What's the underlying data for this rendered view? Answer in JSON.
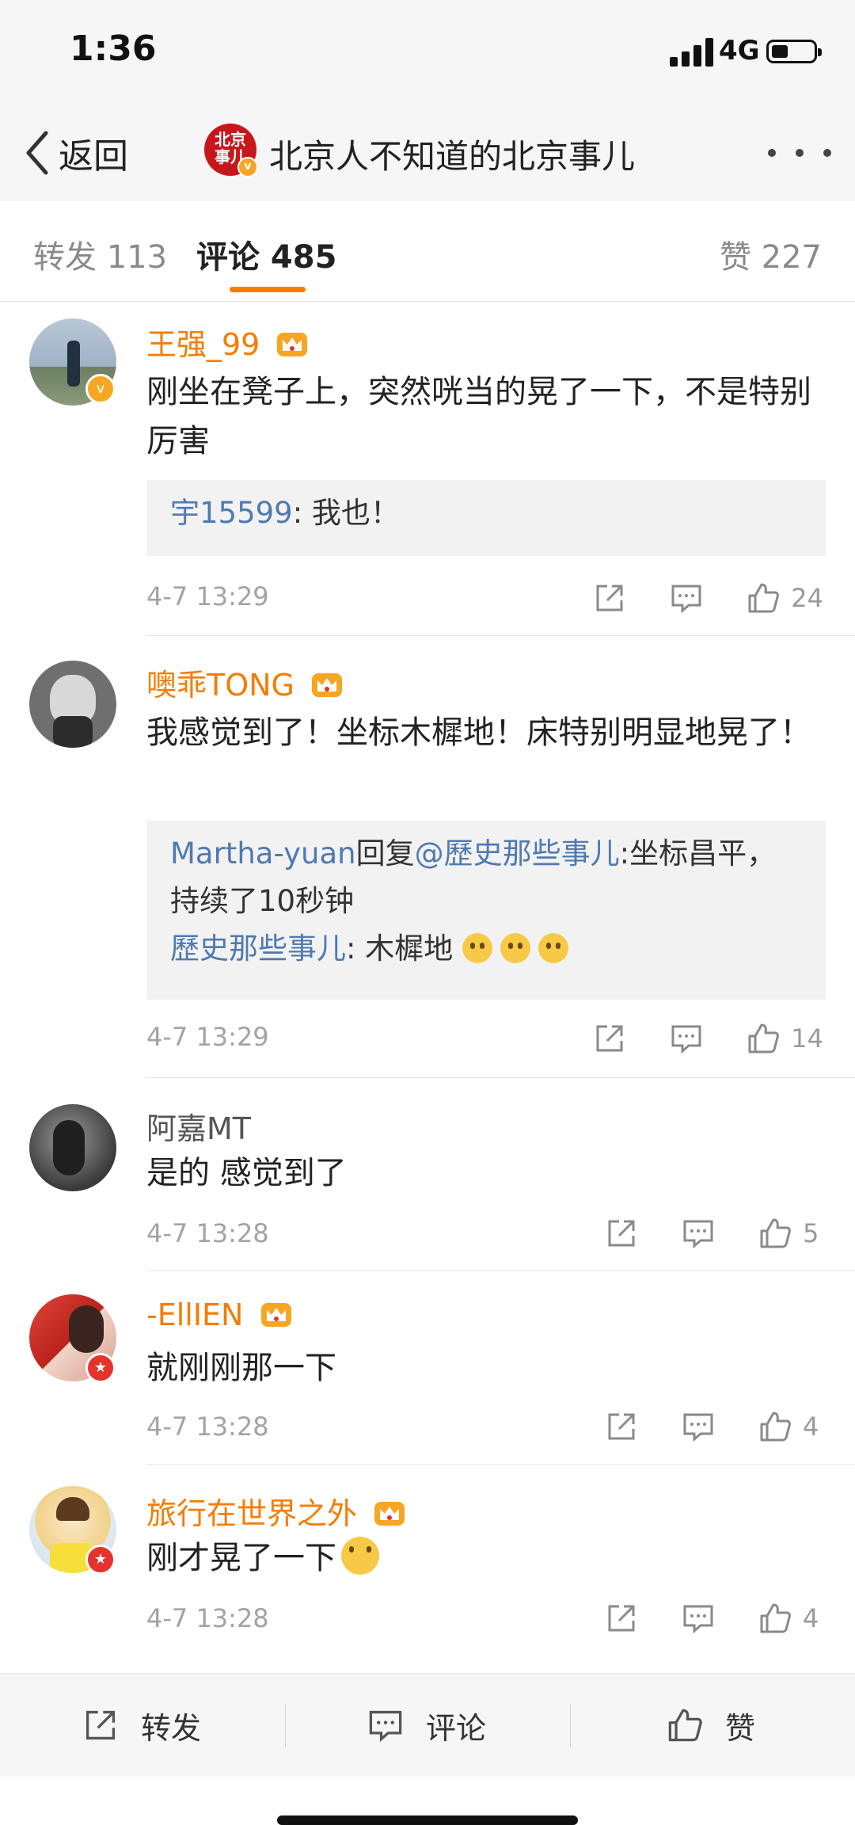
{
  "status_bar": {
    "time": "1:36",
    "network": "4G"
  },
  "nav": {
    "back_label": "返回",
    "title": "北京人不知道的北京事儿",
    "avatar_text": "北京事儿"
  },
  "tabs": [
    {
      "label": "转发 113",
      "active": false
    },
    {
      "label": "评论 485",
      "active": true
    },
    {
      "label": "赞 227",
      "active": false
    }
  ],
  "comments": [
    {
      "username": "王强_99",
      "vip": true,
      "badge": "v-gold",
      "text": "刚坐在凳子上，突然咣当的晃了一下，不是特别厉害",
      "replies": [
        {
          "user": "宇15599",
          "text": ": 我也！"
        }
      ],
      "time": "4-7 13:29",
      "likes": "24"
    },
    {
      "username": "噢乖TONG",
      "vip": true,
      "badge": "",
      "text": "我感觉到了！坐标木樨地！床特别明显地晃了！",
      "replies": [
        {
          "user": "Martha-yuan",
          "mid": "回复",
          "user2": "@歷史那些事儿",
          "text": ":坐标昌平，持续了10秒钟"
        },
        {
          "user": "歷史那些事儿",
          "text": ": 木樨地"
        }
      ],
      "time": "4-7 13:29",
      "likes": "14"
    },
    {
      "username": "阿嘉MT",
      "vip": false,
      "badge": "",
      "text": "是的  感觉到了",
      "replies": [],
      "time": "4-7 13:28",
      "likes": "5"
    },
    {
      "username": "-EllIEN",
      "vip": true,
      "badge": "v-red",
      "text": "就刚刚那一下",
      "replies": [],
      "time": "4-7 13:28",
      "likes": "4"
    },
    {
      "username": "旅行在世界之外",
      "vip": true,
      "badge": "v-red",
      "text": "刚才晃了一下",
      "replies": [],
      "time": "4-7 13:28",
      "likes": "4"
    }
  ],
  "bottom_bar": {
    "repost": "转发",
    "comment": "评论",
    "like": "赞"
  },
  "icons": [
    "back-chevron-icon",
    "more-icon",
    "crown-icon",
    "repost-icon",
    "comment-icon",
    "like-icon",
    "emoji-icon"
  ],
  "colors": {
    "accent": "#fa7d00",
    "username_vip": "#f57c00",
    "reply_link": "#4f7ab1"
  }
}
